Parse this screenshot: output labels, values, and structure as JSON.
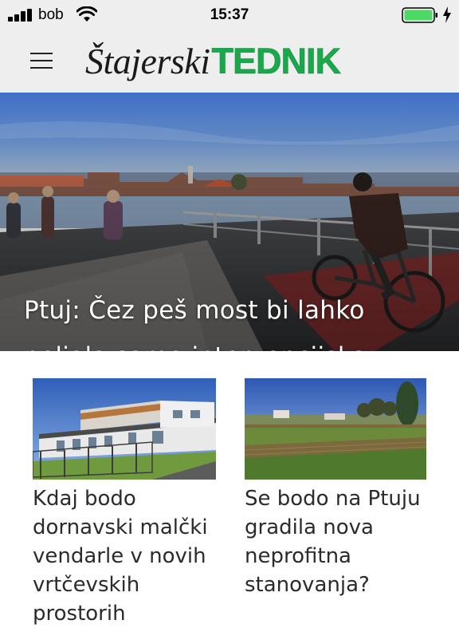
{
  "status_bar": {
    "carrier": "bob",
    "time": "15:37",
    "battery_color": "#4cd964"
  },
  "header": {
    "logo_part1": "Štajerski",
    "logo_part2": "TEDNIK",
    "logo_accent": "#1aa84c",
    "menu_icon": "hamburger-menu-icon"
  },
  "hero": {
    "title": "Ptuj: Čez peš most bi lahko peljala samo intervencijska vozila na nujni vožnji"
  },
  "articles": [
    {
      "title": "Kdaj bodo dornavski malčki vendarle v novih vrtčevskih prostorih"
    },
    {
      "title": "Se bodo na Ptuju gradila nova neprofitna stanovanja?"
    }
  ]
}
